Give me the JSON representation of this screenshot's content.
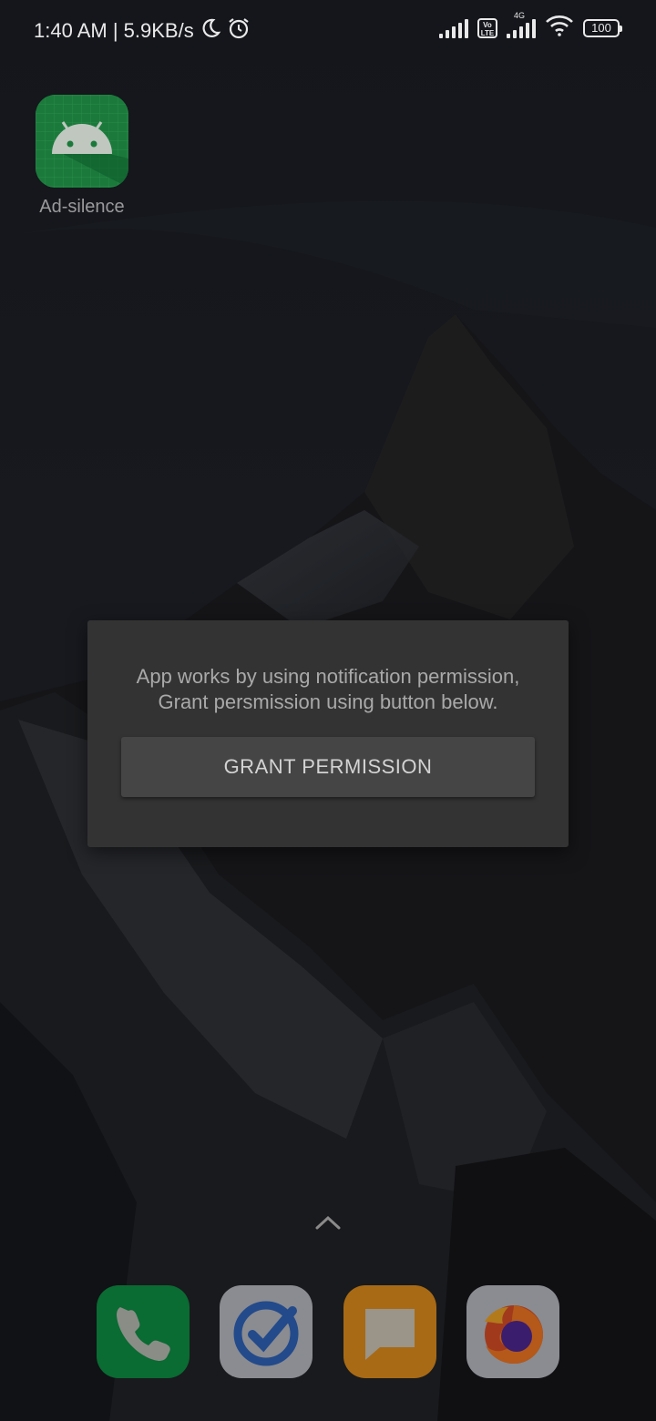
{
  "status_bar": {
    "time_speed": "1:40 AM | 5.9KB/s",
    "network_label": "4G",
    "volte_label": "Vo LTE",
    "battery": "100",
    "icons": [
      "moon-icon",
      "alarm-icon",
      "signal-icon",
      "volte-icon",
      "signal-4g-icon",
      "wifi-icon",
      "battery-icon"
    ]
  },
  "home": {
    "app": {
      "label": "Ad-silence",
      "icon": "android-icon"
    }
  },
  "dialog": {
    "message_line1": "App works by using notification permission,",
    "message_line2": "Grant persmission using button below.",
    "button_label": "GRANT PERMISSION"
  },
  "dock": {
    "apps": [
      {
        "name": "phone",
        "icon": "phone-icon",
        "color": "#0a7a3a"
      },
      {
        "name": "tasks",
        "icon": "check-circle-icon",
        "color": "#8d8f95"
      },
      {
        "name": "messages",
        "icon": "message-icon",
        "color": "#b8781c"
      },
      {
        "name": "firefox",
        "icon": "firefox-icon",
        "color": "#8d8f95"
      }
    ]
  },
  "colors": {
    "dialog_bg": "#333333",
    "button_bg": "#454545",
    "app_icon_green": "#1b7a3b"
  }
}
